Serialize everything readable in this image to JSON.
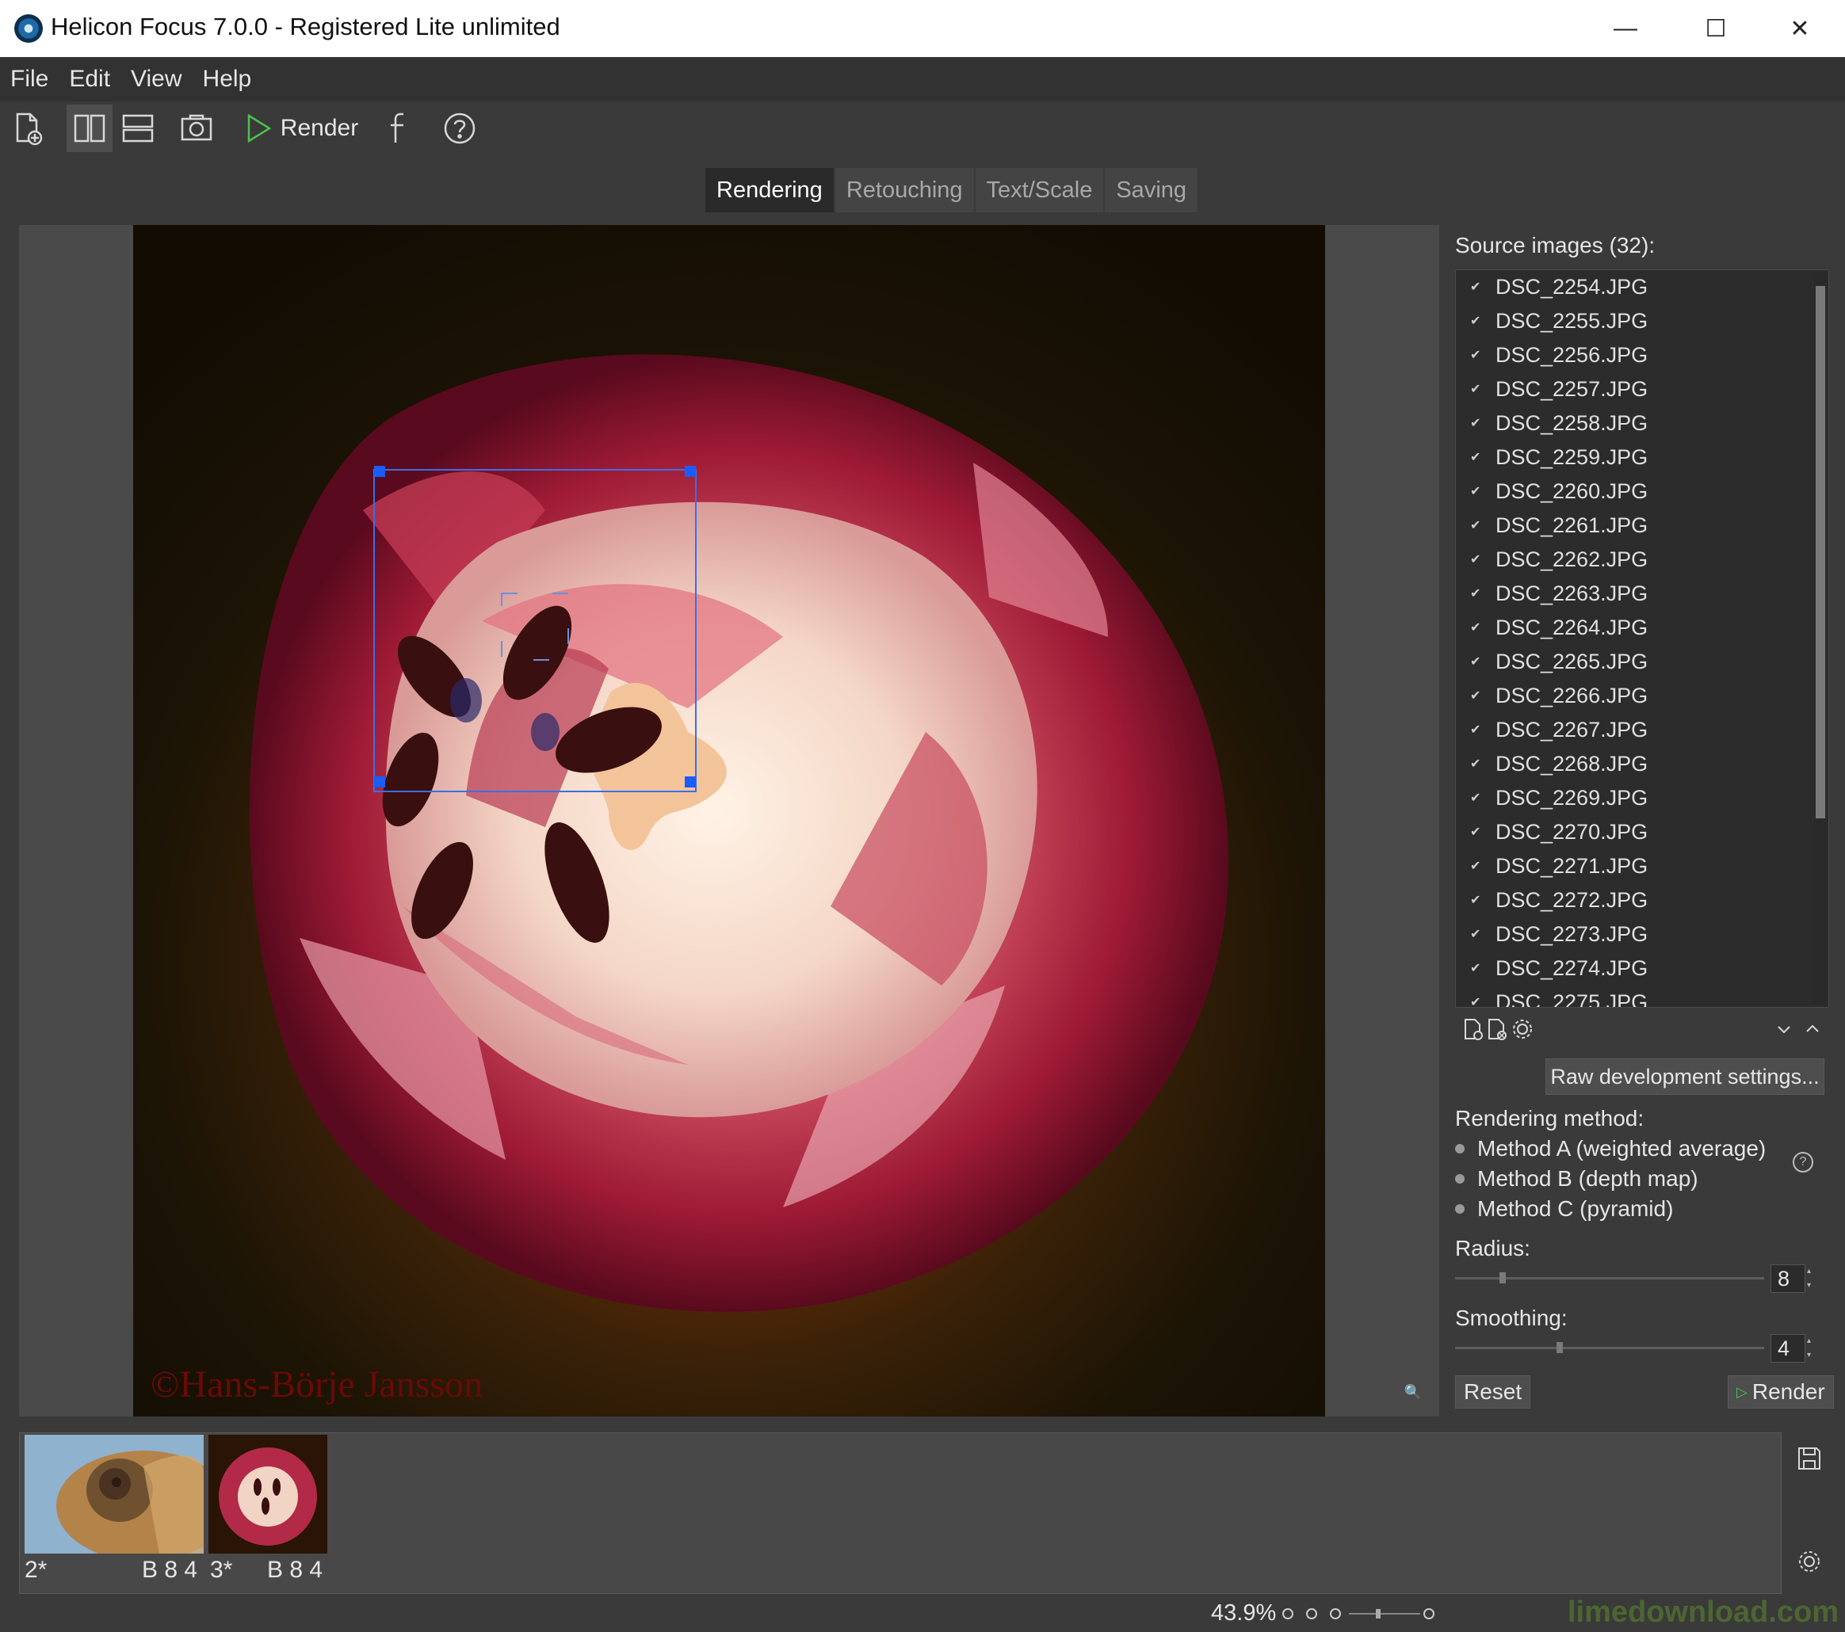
{
  "window": {
    "title": "Helicon Focus 7.0.0 - Registered Lite unlimited",
    "minimize": "—",
    "maximize": "☐",
    "close": "✕"
  },
  "menu": [
    "File",
    "Edit",
    "View",
    "Help"
  ],
  "toolbar": {
    "render_label": "Render"
  },
  "tabs": [
    "Rendering",
    "Retouching",
    "Text/Scale",
    "Saving"
  ],
  "active_tab": "Rendering",
  "viewer": {
    "watermark": "©Hans-Börje Jansson"
  },
  "panel": {
    "source_label": "Source images (32):",
    "files": [
      "DSC_2254.JPG",
      "DSC_2255.JPG",
      "DSC_2256.JPG",
      "DSC_2257.JPG",
      "DSC_2258.JPG",
      "DSC_2259.JPG",
      "DSC_2260.JPG",
      "DSC_2261.JPG",
      "DSC_2262.JPG",
      "DSC_2263.JPG",
      "DSC_2264.JPG",
      "DSC_2265.JPG",
      "DSC_2266.JPG",
      "DSC_2267.JPG",
      "DSC_2268.JPG",
      "DSC_2269.JPG",
      "DSC_2270.JPG",
      "DSC_2271.JPG",
      "DSC_2272.JPG",
      "DSC_2273.JPG",
      "DSC_2274.JPG",
      "DSC_2275.JPG"
    ],
    "raw_button": "Raw development settings...",
    "method_label": "Rendering method:",
    "methods": [
      "Method A (weighted average)",
      "Method B (depth map)",
      "Method C (pyramid)"
    ],
    "radius_label": "Radius:",
    "radius_value": "8",
    "smoothing_label": "Smoothing:",
    "smoothing_value": "4",
    "reset_button": "Reset",
    "render_button": "Render"
  },
  "thumbnails": [
    {
      "index": "2*",
      "params": "B 8 4"
    },
    {
      "index": "3*",
      "params": "B 8 4"
    }
  ],
  "status": {
    "zoom": "43.9%",
    "brand": "limedownload.com"
  },
  "colors": {
    "accent_selection": "#1a5cff",
    "render_green": "#4cc04c"
  }
}
